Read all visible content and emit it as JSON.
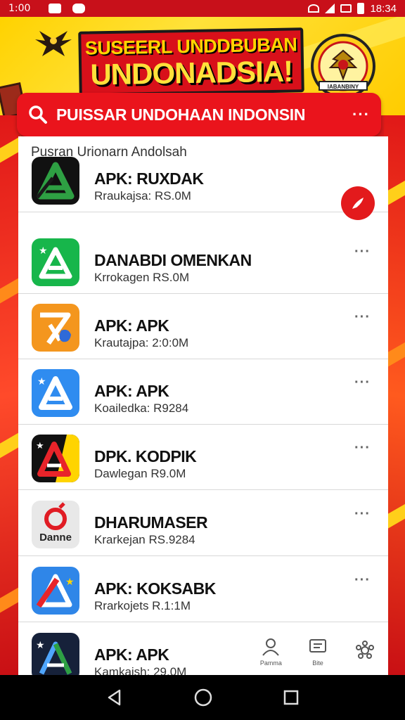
{
  "status_bar": {
    "time_left": "1:00",
    "time_right": "18:34"
  },
  "banner": {
    "title_line1": "SUSEERL UNDDBUBAN",
    "title_line2": "UNDONADSIA!",
    "emblem_text": "IABANBINY"
  },
  "search": {
    "text": "PUISSAR UNDOHAAN INDONSIN",
    "more": "···"
  },
  "section": {
    "title": "Pusran Urionarn Andolsah"
  },
  "apps": [
    {
      "name": "APK: RUXDAK",
      "sub": "Rraukajsa: RS.0M",
      "icon_name": "green-a-dark-icon",
      "colors": [
        "#111111",
        "#2ea043"
      ],
      "action": "fab"
    },
    {
      "name": "DANABDI OMENKAN",
      "sub": "Krrokagen RS.0M",
      "icon_name": "green-a-icon",
      "colors": [
        "#17b64b",
        "#ffffff"
      ],
      "action": "more"
    },
    {
      "name": "APK: APK",
      "sub": "Krautajpa: 2:0:0M",
      "icon_name": "orange-a-icon",
      "colors": [
        "#f4961e",
        "#ffffff"
      ],
      "action": "more"
    },
    {
      "name": "APK: APK",
      "sub": "Koailedka: R9284",
      "icon_name": "blue-a-icon",
      "colors": [
        "#2f8cf0",
        "#ffffff"
      ],
      "action": "more"
    },
    {
      "name": "DPK. KODPIK",
      "sub": "Dawlegan R9.0M",
      "icon_name": "red-yellow-a-icon",
      "colors": [
        "#111111",
        "#ffd400"
      ],
      "action": "more"
    },
    {
      "name": "DHARUMASER",
      "sub": "Krarkejan RS.9284",
      "icon_name": "danne-icon",
      "colors": [
        "#e8e8e8",
        "#e01c24"
      ],
      "icon_label": "Danne",
      "action": "more"
    },
    {
      "name": "APK: KOKSABK",
      "sub": "Rrarkojets R.1:1M",
      "icon_name": "blue-red-a-icon",
      "colors": [
        "#2f86e8",
        "#e8242a"
      ],
      "action": "more"
    },
    {
      "name": "APK: APK",
      "sub": "Kamkajsh: 29.0M",
      "icon_name": "dark-multicolor-a-icon",
      "colors": [
        "#16213a",
        "#4fa6ff"
      ],
      "action": "none"
    }
  ],
  "more_glyph": "···",
  "bottom_nav": [
    {
      "label": "Pamma",
      "icon": "person-icon"
    },
    {
      "label": "Bite",
      "icon": "message-icon"
    },
    {
      "label": "",
      "icon": "settings-icon"
    }
  ],
  "accent_colors": {
    "red": "#e31a1c",
    "yellow": "#ffd200"
  }
}
